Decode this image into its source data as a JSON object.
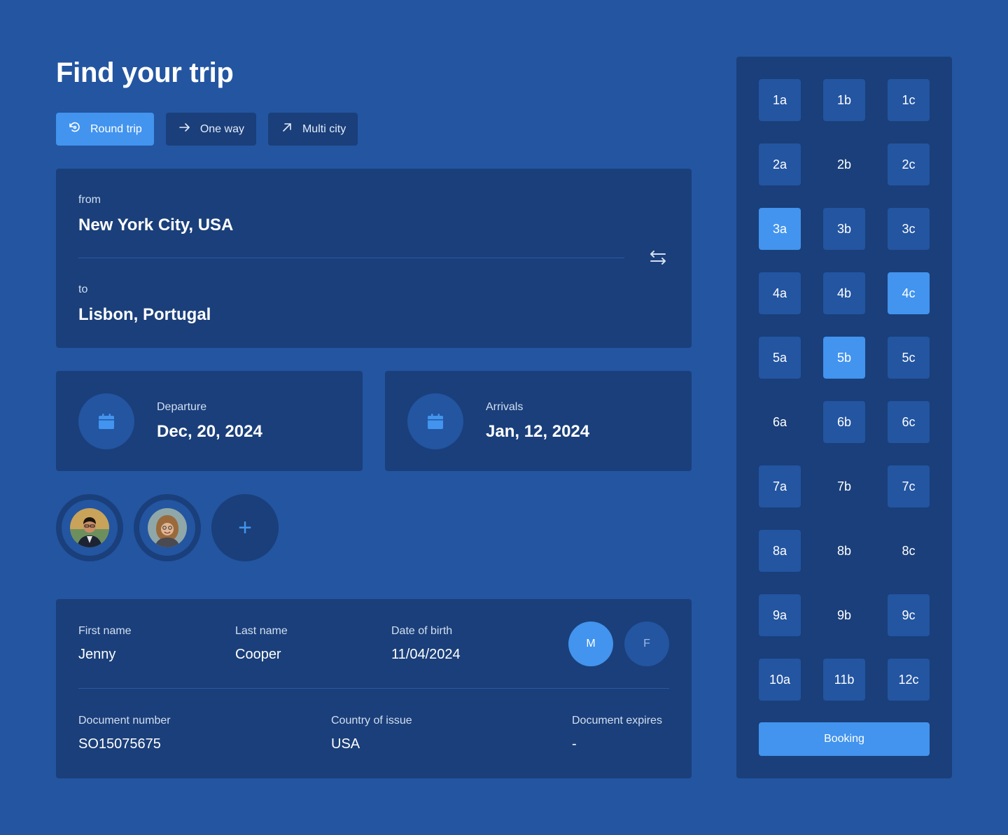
{
  "page": {
    "title": "Find your trip"
  },
  "trip_types": [
    {
      "label": "Round trip",
      "icon": "round-trip-icon",
      "active": true
    },
    {
      "label": "One way",
      "icon": "arrow-right-icon",
      "active": false
    },
    {
      "label": "Multi city",
      "icon": "arrow-up-right-icon",
      "active": false
    }
  ],
  "route": {
    "from_label": "from",
    "from_value": "New York City, USA",
    "to_label": "to",
    "to_value": "Lisbon, Portugal",
    "swap_icon": "swap-icon"
  },
  "departure": {
    "label": "Departure",
    "value": "Dec, 20, 2024",
    "icon": "calendar-icon"
  },
  "arrival": {
    "label": "Arrivals",
    "value": "Jan, 12, 2024",
    "icon": "calendar-icon"
  },
  "passengers": {
    "avatars": [
      "passenger-avatar-man",
      "passenger-avatar-woman"
    ],
    "add_label": "+"
  },
  "traveler": {
    "first_name_label": "First name",
    "first_name": "Jenny",
    "last_name_label": "Last name",
    "last_name": "Cooper",
    "dob_label": "Date of birth",
    "dob": "11/04/2024",
    "gender_m": "M",
    "gender_f": "F",
    "gender_selected": "M",
    "doc_number_label": "Document number",
    "doc_number": "SO15075675",
    "country_label": "Country of issue",
    "country": "USA",
    "doc_expires_label": "Document expires",
    "doc_expires": "-"
  },
  "seats": [
    {
      "label": "1a",
      "state": "available"
    },
    {
      "label": "1b",
      "state": "available"
    },
    {
      "label": "1c",
      "state": "available"
    },
    {
      "label": "2a",
      "state": "available"
    },
    {
      "label": "2b",
      "state": "unavailable"
    },
    {
      "label": "2c",
      "state": "available"
    },
    {
      "label": "3a",
      "state": "selected"
    },
    {
      "label": "3b",
      "state": "available"
    },
    {
      "label": "3c",
      "state": "available"
    },
    {
      "label": "4a",
      "state": "available"
    },
    {
      "label": "4b",
      "state": "available"
    },
    {
      "label": "4c",
      "state": "selected"
    },
    {
      "label": "5a",
      "state": "available"
    },
    {
      "label": "5b",
      "state": "selected"
    },
    {
      "label": "5c",
      "state": "available"
    },
    {
      "label": "6a",
      "state": "unavailable"
    },
    {
      "label": "6b",
      "state": "available"
    },
    {
      "label": "6c",
      "state": "available"
    },
    {
      "label": "7a",
      "state": "available"
    },
    {
      "label": "7b",
      "state": "unavailable"
    },
    {
      "label": "7c",
      "state": "available"
    },
    {
      "label": "8a",
      "state": "available"
    },
    {
      "label": "8b",
      "state": "unavailable"
    },
    {
      "label": "8c",
      "state": "unavailable"
    },
    {
      "label": "9a",
      "state": "available"
    },
    {
      "label": "9b",
      "state": "unavailable"
    },
    {
      "label": "9c",
      "state": "available"
    },
    {
      "label": "10a",
      "state": "available"
    },
    {
      "label": "11b",
      "state": "available"
    },
    {
      "label": "12c",
      "state": "available"
    }
  ],
  "booking_label": "Booking",
  "colors": {
    "background": "#2355a1",
    "card": "#1a3f7a",
    "accent": "#4294ee"
  }
}
